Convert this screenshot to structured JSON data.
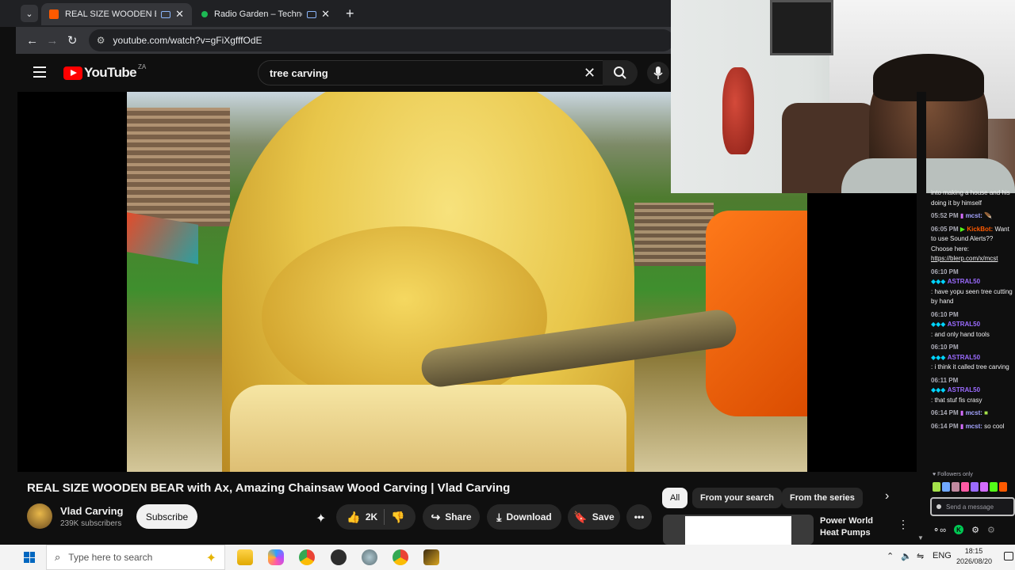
{
  "browser": {
    "tabs": [
      {
        "title": "REAL SIZE WOODEN BEAR",
        "active": true,
        "favicon_color": "#ff5a00"
      },
      {
        "title": "Radio Garden – Techno Und",
        "active": false,
        "favicon_color": "#1db954"
      }
    ],
    "url": "youtube.com/watch?v=gFiXgfffOdE"
  },
  "youtube": {
    "logo_text": "YouTube",
    "region": "ZA",
    "search_value": "tree carving",
    "video_title": "REAL SIZE WOODEN BEAR with Ax, Amazing Chainsaw Wood Carving | Vlad Carving",
    "channel": {
      "name": "Vlad Carving",
      "subscribers": "239K subscribers"
    },
    "subscribe_label": "Subscribe",
    "actions": {
      "likes": "2K",
      "share": "Share",
      "download": "Download",
      "save": "Save"
    },
    "chips": [
      "All",
      "From your search",
      "From the series"
    ],
    "recommendation": {
      "title": "Power World Heat Pumps"
    }
  },
  "chat": {
    "messages": [
      {
        "time": "",
        "user": "",
        "text": "into making a house and his doing it by himself"
      },
      {
        "time": "05:52 PM",
        "user": "mcst:",
        "text": ""
      },
      {
        "time": "06:05 PM",
        "user": "KickBot:",
        "text": "Want to use Sound Alerts?? Choose here:",
        "link": "https://blerp.com/x/mcst"
      },
      {
        "time": "06:10 PM",
        "user": "ASTRAL50",
        "text": ": have yopu seen tree cutting by hand"
      },
      {
        "time": "06:10 PM",
        "user": "ASTRAL50",
        "text": ": and only hand tools"
      },
      {
        "time": "06:10 PM",
        "user": "ASTRAL50",
        "text": ": i think it called tree carving"
      },
      {
        "time": "06:11 PM",
        "user": "ASTRAL50",
        "text": ": that stuf fis crasy"
      },
      {
        "time": "06:14 PM",
        "user": "mcst:",
        "text": ""
      },
      {
        "time": "06:14 PM",
        "user": "mcst:",
        "text": "so cool"
      }
    ],
    "followers_only": "Followers only",
    "input_placeholder": "Send a message"
  },
  "taskbar": {
    "search_placeholder": "Type here to search",
    "language": "ENG",
    "time": "18:15",
    "date": "2026/08/20"
  },
  "colors": {
    "kick_green": "#53fc18",
    "astral_purple": "#9b6bff",
    "kickbot_orange": "#ff5a00"
  }
}
